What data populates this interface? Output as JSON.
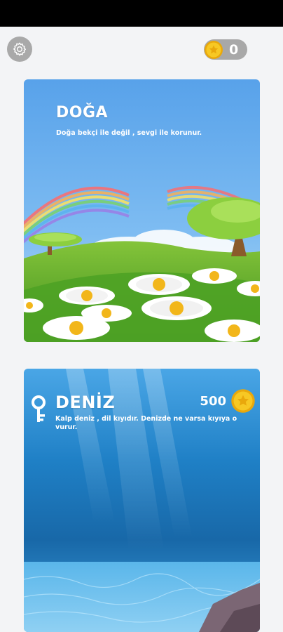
{
  "header": {
    "coin_count": "0"
  },
  "levels": [
    {
      "title": "DOĞA",
      "description": "Doğa bekçi ile değil , sevgi ile korunur."
    },
    {
      "title": "DENİZ",
      "description": "Kalp deniz , dil kıyıdır. Denizde ne varsa kıyıya o vurur.",
      "price": "500"
    }
  ],
  "icons": {
    "settings": "gear-icon",
    "coin": "coin-icon",
    "lock": "key-icon"
  },
  "colors": {
    "coin_gold": "#f5c518",
    "sky": "#5aa6ea",
    "sea": "#1f74b8"
  }
}
